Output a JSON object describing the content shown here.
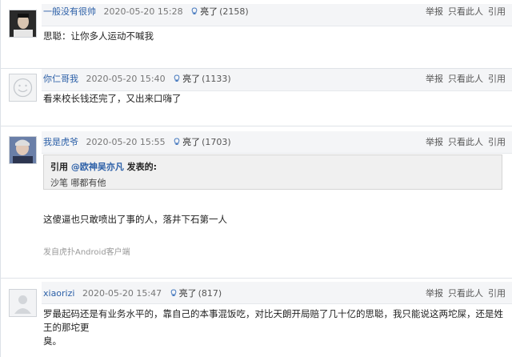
{
  "posts": [
    {
      "username": "一般没有很帅",
      "time": "2020-05-20 15:28",
      "light_label": "亮了",
      "light_count": "(2158)",
      "content": "思聪：让你多人运动不喊我",
      "actions": {
        "report": "举报",
        "only_this": "只看此人",
        "quote": "引用"
      },
      "avatar_icon": "user-photo-avatar"
    },
    {
      "username": "你仁哥我",
      "time": "2020-05-20 15:40",
      "light_label": "亮了",
      "light_count": "(1133)",
      "content": "看来校长钱还完了，又出来口嗨了",
      "actions": {
        "report": "举报",
        "only_this": "只看此人",
        "quote": "引用"
      },
      "avatar_icon": "default-smiley-avatar"
    },
    {
      "username": "我是虎爷",
      "time": "2020-05-20 15:55",
      "light_label": "亮了",
      "light_count": "(1703)",
      "quote": {
        "prefix": "引用 ",
        "user": "@欧神吴亦凡",
        "suffix": " 发表的:",
        "body": "沙笔 哪都有他"
      },
      "content": "这傻逼也只敢喷出了事的人，落井下石第一人",
      "source": "发自虎扑Android客户端",
      "actions": {
        "report": "举报",
        "only_this": "只看此人",
        "quote": "引用"
      },
      "avatar_icon": "user-photo-avatar"
    },
    {
      "username": "xiaorizi",
      "time": "2020-05-20 15:47",
      "light_label": "亮了",
      "light_count": "(817)",
      "content_line1": "罗最起码还是有业务水平的，靠自己的本事混饭吃，对比天朗开局赔了几十亿的思聪，我只能说这两坨屎，还是姓王的那坨更",
      "content_line2": "臭。",
      "actions": {
        "report": "举报",
        "only_this": "只看此人",
        "quote": "引用"
      },
      "avatar_icon": "default-person-avatar"
    }
  ],
  "colors": {
    "username": "#2b5fa7",
    "header_bg": "#f4f5f7"
  }
}
